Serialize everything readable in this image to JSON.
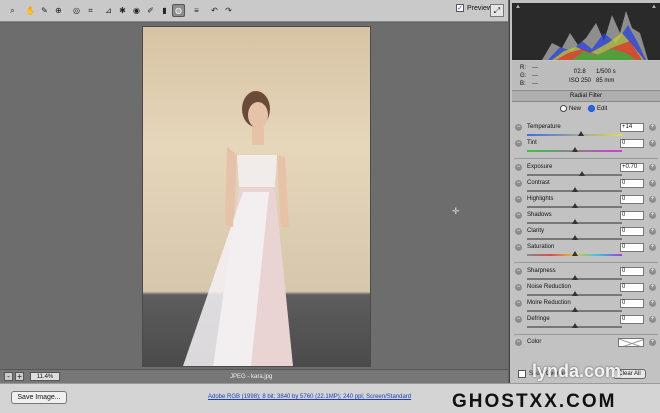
{
  "toolbar": {
    "tools": [
      {
        "icon": "zoom-icon",
        "glyph": "⌕"
      },
      {
        "icon": "hand-icon",
        "glyph": "✋"
      },
      {
        "icon": "white-balance-icon",
        "glyph": "✎"
      },
      {
        "icon": "color-sampler-icon",
        "glyph": "⊕"
      },
      {
        "icon": "target-adjustment-icon",
        "glyph": "◎"
      },
      {
        "icon": "crop-icon",
        "glyph": "⌗"
      },
      {
        "icon": "straighten-icon",
        "glyph": "⊿"
      },
      {
        "icon": "spot-removal-icon",
        "glyph": "✱"
      },
      {
        "icon": "red-eye-icon",
        "glyph": "◉"
      },
      {
        "icon": "adjustment-brush-icon",
        "glyph": "✐"
      },
      {
        "icon": "graduated-filter-icon",
        "glyph": "▮"
      },
      {
        "icon": "radial-filter-icon",
        "glyph": "◍",
        "active": true
      },
      {
        "icon": "preferences-icon",
        "glyph": "≡"
      },
      {
        "icon": "rotate-left-icon",
        "glyph": "↶"
      },
      {
        "icon": "rotate-right-icon",
        "glyph": "↷"
      }
    ],
    "preview_label": "Preview",
    "preview_checked": true
  },
  "status": {
    "zoom": "11.4%",
    "filename": "JPEG  -  kara.jpg"
  },
  "histogram": {
    "rgb_labels": [
      "R:",
      "G:",
      "B:"
    ],
    "rgb_values": [
      "---",
      "---",
      "---"
    ],
    "aperture": "f/2.8",
    "shutter": "1/500 s",
    "iso": "ISO 250",
    "focal": "85 mm"
  },
  "filter": {
    "title": "Radial Filter",
    "mode_new": "New",
    "mode_edit": "Edit",
    "mode_selected": "Edit",
    "controls": [
      {
        "label": "Temperature",
        "value": "+14",
        "pos": 0.57,
        "track": "temp"
      },
      {
        "label": "Tint",
        "value": "0",
        "pos": 0.5,
        "track": "tint"
      },
      {
        "label": "Exposure",
        "value": "+0.70",
        "pos": 0.58,
        "track": "plain"
      },
      {
        "label": "Contrast",
        "value": "0",
        "pos": 0.5,
        "track": "plain"
      },
      {
        "label": "Highlights",
        "value": "0",
        "pos": 0.5,
        "track": "plain"
      },
      {
        "label": "Shadows",
        "value": "0",
        "pos": 0.5,
        "track": "plain"
      },
      {
        "label": "Clarity",
        "value": "0",
        "pos": 0.5,
        "track": "plain"
      },
      {
        "label": "Saturation",
        "value": "0",
        "pos": 0.5,
        "track": "sat"
      },
      {
        "label": "Sharpness",
        "value": "0",
        "pos": 0.5,
        "track": "plain"
      },
      {
        "label": "Noise Reduction",
        "value": "0",
        "pos": 0.5,
        "track": "plain"
      },
      {
        "label": "Moire Reduction",
        "value": "0",
        "pos": 0.5,
        "track": "plain"
      },
      {
        "label": "Defringe",
        "value": "0",
        "pos": 0.5,
        "track": "plain"
      }
    ],
    "color_label": "Color",
    "show_overlay": "Show Overlay",
    "clear_all": "Clear All"
  },
  "bottom": {
    "save_label": "Save Image...",
    "workflow_link": "Adobe RGB (1998); 8 bit; 3840 by 5760 (22.1MP); 240 ppi; Screen/Standard"
  },
  "watermarks": {
    "lynda": "lynda.com",
    "ghost": "GHOSTXX.COM"
  }
}
